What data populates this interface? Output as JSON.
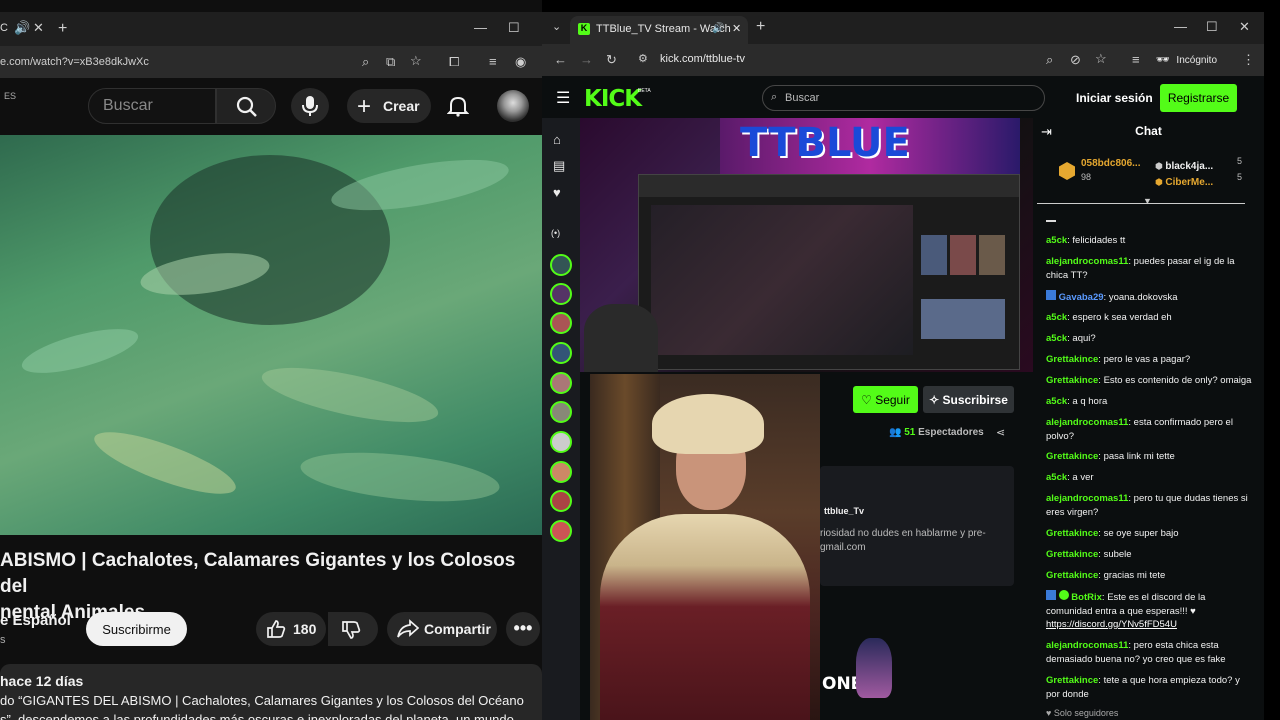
{
  "youtube_window": {
    "tab_title_fragment": "C",
    "url": "e.com/watch?v=xB3e8dkJwXc",
    "country_code": "ES",
    "search_placeholder": "Buscar",
    "create_label": "Crear",
    "video_title_line1": "ABISMO | Cachalotes, Calamares Gigantes y los Colosos del",
    "video_title_line2": "nental Animales",
    "channel_name": "e Español",
    "channel_sub": "s",
    "subscribe_label": "Suscribirme",
    "likes": "180",
    "share_label": "Compartir",
    "upload_age": "hace 12 días",
    "desc_line1": "do “GIGANTES DEL ABISMO | Cachalotes, Calamares Gigantes y los Colosos del Océano",
    "desc_line2": "s”, descendemos a las profundidades más oscuras e inexploradas del planeta, un mundo"
  },
  "kick_window": {
    "tab_title": "TTBlue_TV Stream - Watch",
    "url": "kick.com/ttblue-tv",
    "incognito_label": "Incógnito",
    "logo": "KICK",
    "logo_badge": "BETA",
    "search_placeholder": "Buscar",
    "login_label": "Iniciar sesión",
    "register_label": "Registrarse",
    "stream_overlay_text": "TTBLUE",
    "follow_label": "Seguir",
    "subscribe_label": "Suscribirse",
    "viewers_count": "51",
    "viewers_label": "Espectadores",
    "channel_handle": "ttblue_Tv",
    "bio_line1": "riosidad no dudes en hablarme y pre-",
    "bio_line2": "gmail.com",
    "banner_text": "ONES",
    "chat": {
      "title": "Chat",
      "leaders": [
        {
          "name": "058bdc806...",
          "score": "98"
        },
        {
          "name": "black4ja...",
          "score": "5"
        },
        {
          "name": "CiberMe...",
          "score": "5"
        }
      ],
      "messages": [
        {
          "user": "a5ck",
          "text": "felicidades tt"
        },
        {
          "user": "alejandrocomas11",
          "text": "puedes pasar el ig de la chica TT?"
        },
        {
          "user": "Gavaba29",
          "text": "yoana.dokovska"
        },
        {
          "user": "a5ck",
          "text": "espero k sea verdad eh"
        },
        {
          "user": "a5ck",
          "text": "aqui?"
        },
        {
          "user": "Grettakince",
          "text": "pero le vas a pagar?"
        },
        {
          "user": "Grettakince",
          "text": "Esto es contenido de only? omaiga"
        },
        {
          "user": "a5ck",
          "text": "a q hora"
        },
        {
          "user": "alejandrocomas11",
          "text": "esta confirmado pero el polvo?"
        },
        {
          "user": "Grettakince",
          "text": "pasa link mi tette"
        },
        {
          "user": "a5ck",
          "text": "a ver"
        },
        {
          "user": "alejandrocomas11",
          "text": "pero tu que dudas tienes si eres virgen?"
        },
        {
          "user": "Grettakince",
          "text": "se oye super bajo"
        },
        {
          "user": "Grettakince",
          "text": "subele"
        },
        {
          "user": "Grettakince",
          "text": "gracias mi tete"
        },
        {
          "user": "BotRix",
          "text": "Este es el discord de la comunidad entra a que esperas!!! ♥",
          "link": "https://discord.gg/YNv5fFD54U"
        },
        {
          "user": "alejandrocomas11",
          "text": "pero esta chica esta demasiado buena no? yo creo que es fake"
        },
        {
          "user": "Grettakince",
          "text": "tete a que hora empieza todo? y por donde"
        }
      ],
      "footer": "Solo seguidores"
    }
  },
  "colors": {
    "kick_green": "#53fc18",
    "youtube_bg": "#0f0f0f",
    "kick_bg": "#0b0e0f"
  }
}
